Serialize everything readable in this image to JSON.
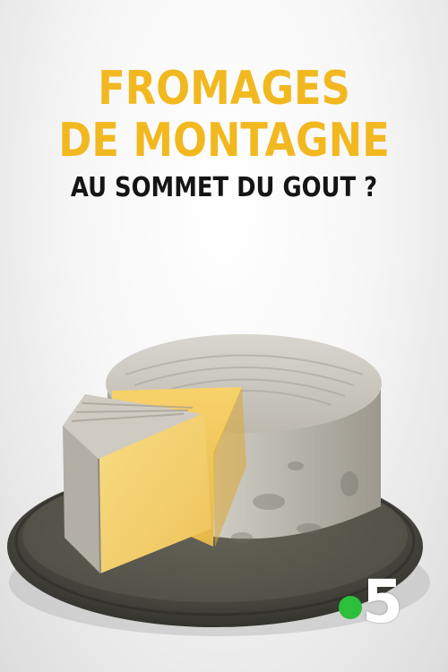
{
  "title": {
    "line1": "FROMAGES",
    "line2": "DE MONTAGNE",
    "subtitle": "AU SOMMET DU GOUT ?"
  },
  "colors": {
    "title": "#f2b81f",
    "subtitle": "#151515",
    "channel_dot": "#2bbf3a"
  },
  "channel_logo": {
    "number": "5",
    "icon": "france5-logo-icon"
  }
}
